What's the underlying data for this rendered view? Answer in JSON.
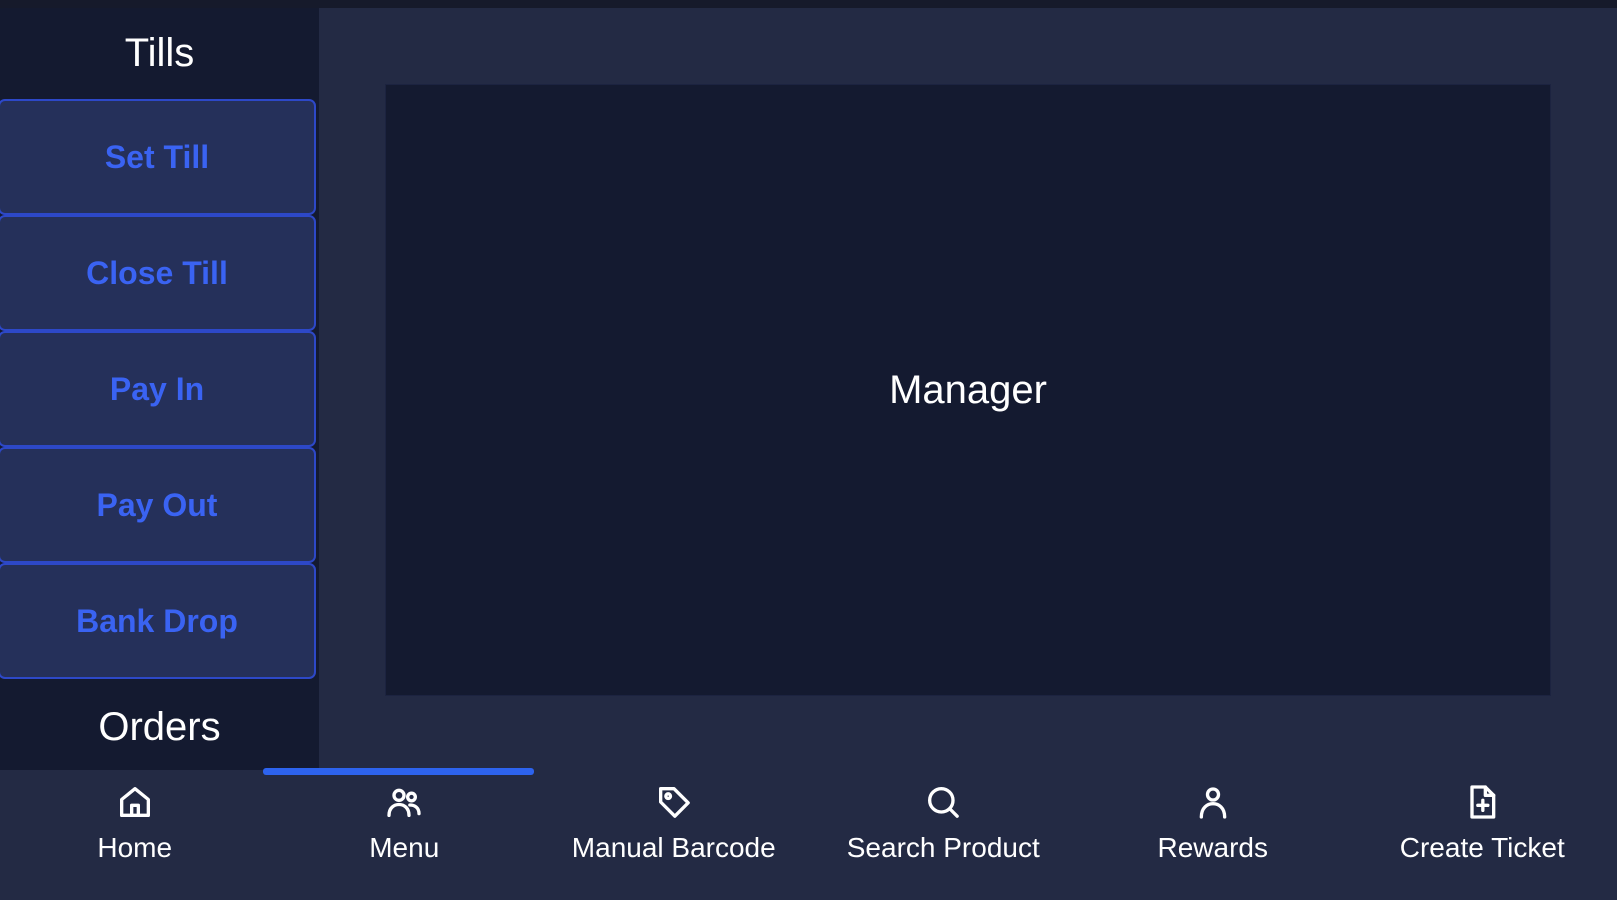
{
  "sidebar": {
    "tills_heading": "Tills",
    "tills": [
      {
        "label": "Set Till"
      },
      {
        "label": "Close Till"
      },
      {
        "label": "Pay In"
      },
      {
        "label": "Pay Out"
      },
      {
        "label": "Bank Drop"
      }
    ],
    "orders_heading": "Orders"
  },
  "main": {
    "panel_title": "Manager"
  },
  "bottom_nav": {
    "active_index": 1,
    "items": [
      {
        "label": "Home",
        "icon": "home-icon"
      },
      {
        "label": "Menu",
        "icon": "users-icon"
      },
      {
        "label": "Manual Barcode",
        "icon": "tag-icon"
      },
      {
        "label": "Search Product",
        "icon": "search-icon"
      },
      {
        "label": "Rewards",
        "icon": "user-icon"
      },
      {
        "label": "Create Ticket",
        "icon": "file-plus-icon"
      }
    ]
  },
  "colors": {
    "accent": "#2d63ee",
    "button_text": "#3a63f2",
    "button_bg": "#25305a",
    "panel_bg": "#141a30",
    "main_bg": "#232a44"
  }
}
